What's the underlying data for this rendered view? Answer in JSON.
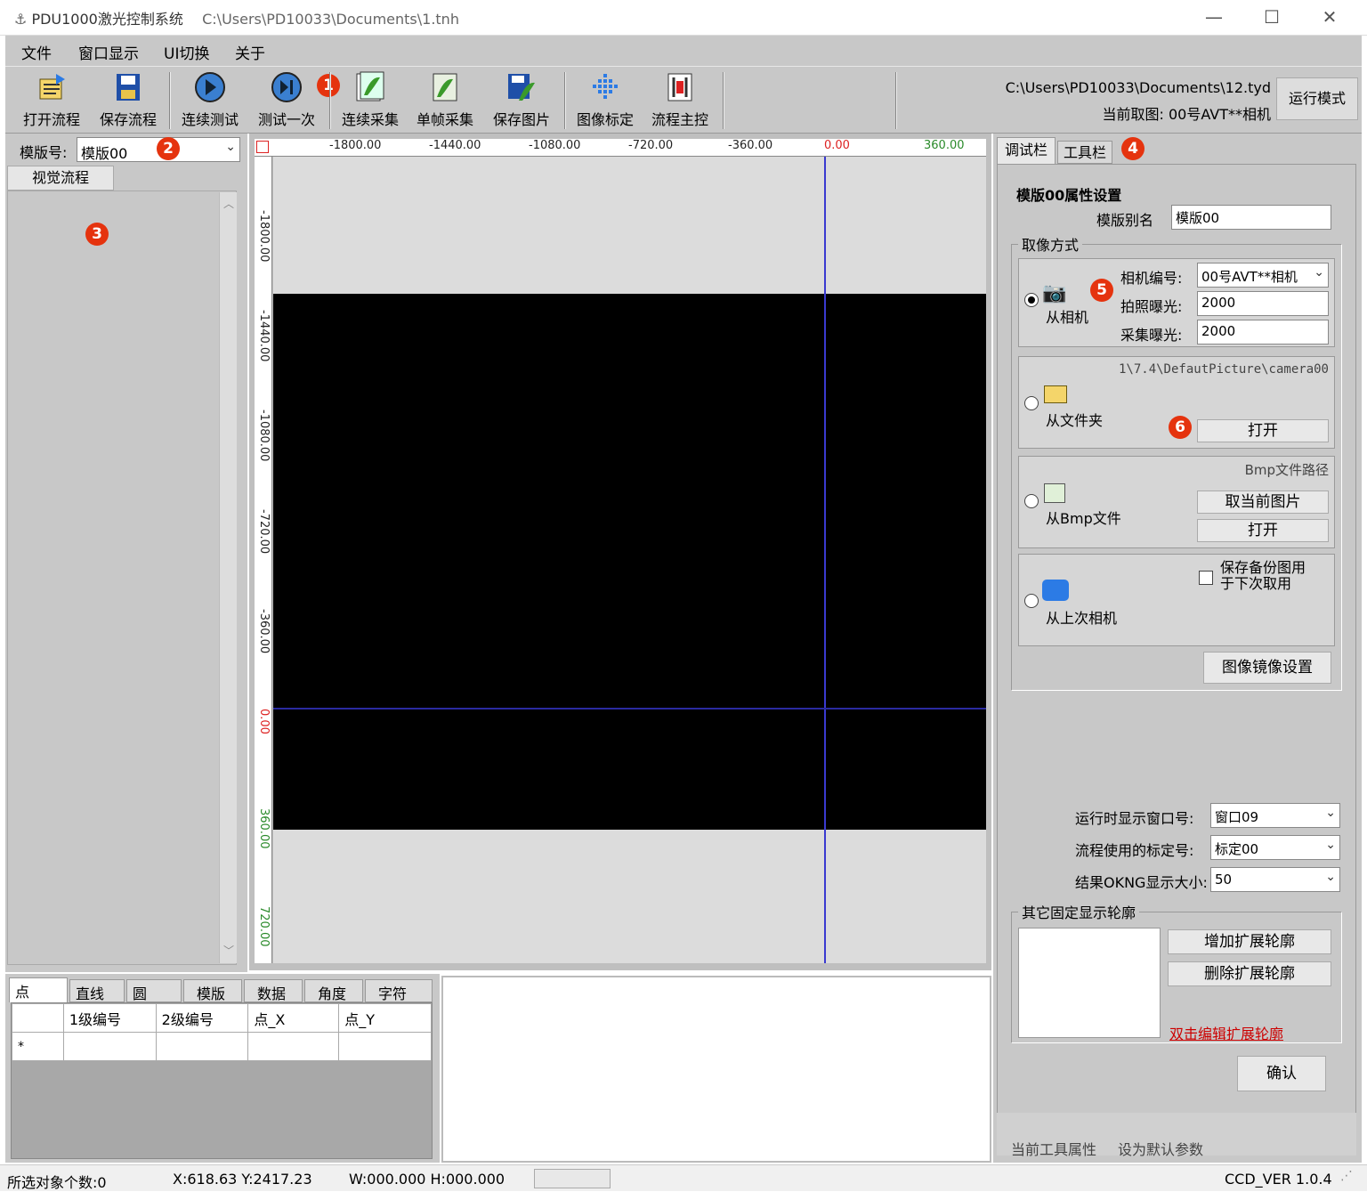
{
  "window": {
    "app_title": "PDU1000激光控制系统",
    "file_path": "C:\\Users\\PD10033\\Documents\\1.tnh",
    "minimize_glyph": "—",
    "maximize_glyph": "☐",
    "close_glyph": "✕"
  },
  "menu": [
    "文件",
    "窗口显示",
    "UI切换",
    "关于"
  ],
  "toolbar": {
    "buttons": [
      {
        "label": "打开流程",
        "icon": "open-flow-icon"
      },
      {
        "label": "保存流程",
        "icon": "save-flow-icon"
      },
      {
        "label": "连续测试",
        "icon": "continuous-test-icon"
      },
      {
        "label": "测试一次",
        "icon": "test-once-icon"
      },
      {
        "label": "连续采集",
        "icon": "continuous-capture-icon"
      },
      {
        "label": "单帧采集",
        "icon": "single-capture-icon"
      },
      {
        "label": "保存图片",
        "icon": "save-image-icon"
      },
      {
        "label": "图像标定",
        "icon": "calibration-icon"
      },
      {
        "label": "流程主控",
        "icon": "flow-control-icon"
      }
    ],
    "config_path": "C:\\Users\\PD10033\\Documents\\12.tyd",
    "current_capture": "当前取图: 00号AVT**相机",
    "run_mode_label": "运行模式"
  },
  "badges": [
    "1",
    "2",
    "3",
    "4",
    "5",
    "6"
  ],
  "left": {
    "template_label": "模版号:",
    "template_value": "模版00",
    "tab": "视觉流程"
  },
  "ruler": {
    "top": [
      "-1800.00",
      "-1440.00",
      "-1080.00",
      "-720.00",
      "-360.00",
      "0.00",
      "360.00"
    ],
    "left": [
      "-1800.00",
      "-1440.00",
      "-1080.00",
      "-720.00",
      "-360.00",
      "0.00",
      "360.00",
      "720.00"
    ]
  },
  "right": {
    "tabs": [
      "调试栏",
      "工具栏"
    ],
    "heading": "模版00属性设置",
    "alias_label": "模版别名",
    "alias_value": "模版00",
    "acquire_group": "取像方式",
    "from_camera": "从相机",
    "camera_no_label": "相机编号:",
    "camera_no_value": "00号AVT**相机",
    "photo_exposure_label": "拍照曝光:",
    "photo_exposure_value": "2000",
    "capture_exposure_label": "采集曝光:",
    "capture_exposure_value": "2000",
    "folder_path": "1\\7.4\\DefautPicture\\camera00",
    "from_folder": "从文件夹",
    "open_label": "打开",
    "bmp_path_label": "Bmp文件路径",
    "from_bmp": "从Bmp文件",
    "take_current_label": "取当前图片",
    "open_label2": "打开",
    "save_backup_label": "保存备份图用于下次取用",
    "from_last_camera": "从上次相机",
    "mirror_settings_label": "图像镜像设置",
    "run_window_label": "运行时显示窗口号:",
    "run_window_value": "窗口09",
    "calib_label": "流程使用的标定号:",
    "calib_value": "标定00",
    "oknsize_label": "结果OKNG显示大小:",
    "oknsize_value": "50",
    "contour_group": "其它固定显示轮廓",
    "add_contour_label": "增加扩展轮廓",
    "del_contour_label": "删除扩展轮廓",
    "edit_contour_link": "双击编辑扩展轮廓",
    "confirm_label": "确认",
    "footer_props": "当前工具属性",
    "footer_default": "设为默认参数"
  },
  "bottom": {
    "tabs": [
      "点",
      "直线",
      "圆",
      "模版",
      "数据",
      "角度",
      "字符串"
    ],
    "columns": [
      "",
      "1级编号",
      "2级编号",
      "点_X",
      "点_Y"
    ],
    "new_row_marker": "*"
  },
  "status": {
    "selected": "所选对象个数:0",
    "coords": "X:618.63 Y:2417.23",
    "size": "W:000.000 H:000.000",
    "version": "CCD_VER 1.0.4"
  }
}
